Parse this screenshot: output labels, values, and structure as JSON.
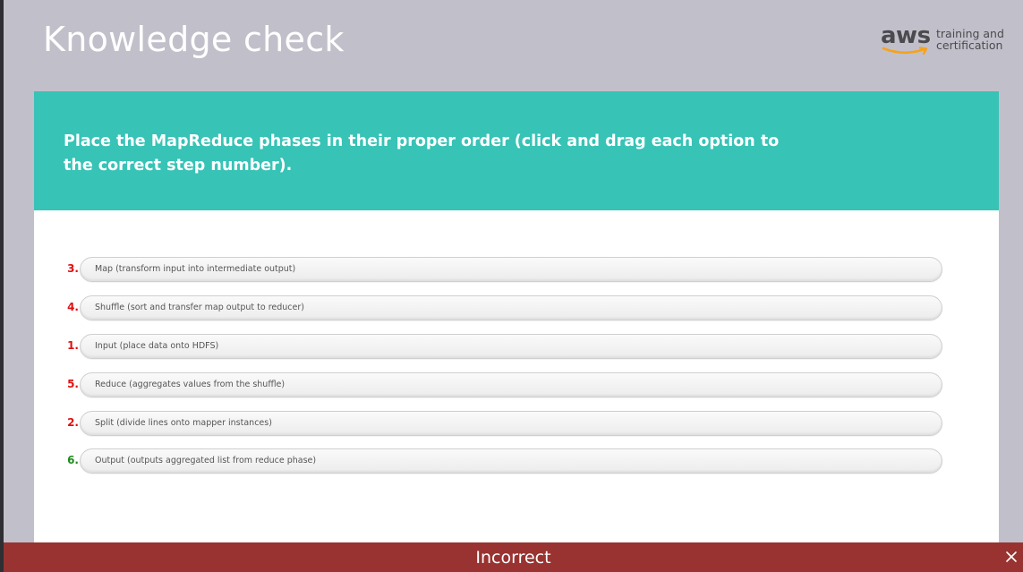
{
  "header": {
    "title": "Knowledge check",
    "logo": {
      "brand": "aws",
      "tagline_line1": "training and",
      "tagline_line2": "certification",
      "smile_color": "#f7a21b"
    }
  },
  "question": {
    "prompt": "Place the MapReduce phases in their proper order (click and drag each option to the correct step number).",
    "banner_color": "#37c3b6"
  },
  "options": [
    {
      "number": "3.",
      "label": "Map (transform input into intermediate output)",
      "status": "incorrect"
    },
    {
      "number": "4.",
      "label": "Shuffle (sort and transfer map output to reducer)",
      "status": "incorrect"
    },
    {
      "number": "1.",
      "label": "Input (place data onto HDFS)",
      "status": "incorrect"
    },
    {
      "number": "5.",
      "label": "Reduce (aggregates values from the shuffle)",
      "status": "incorrect"
    },
    {
      "number": "2.",
      "label": "Split (divide lines onto mapper instances)",
      "status": "incorrect"
    },
    {
      "number": "6.",
      "label": "Output (outputs aggregated list from reduce phase)",
      "status": "correct"
    }
  ],
  "feedback": {
    "text": "Incorrect",
    "color": "#983331",
    "close_icon": "close-icon"
  },
  "colors": {
    "incorrect_number": "#e01010",
    "correct_number": "#1e8a1e"
  }
}
